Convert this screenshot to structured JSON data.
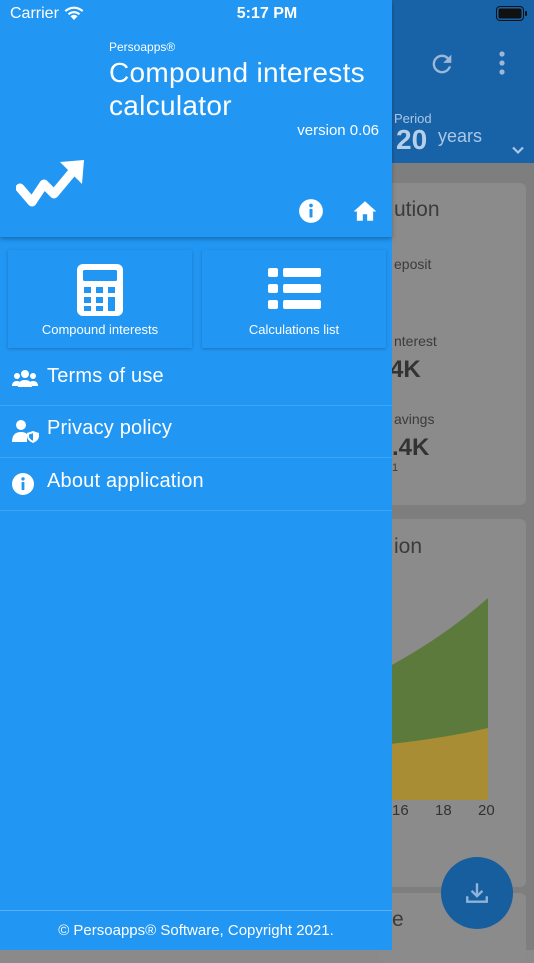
{
  "status_bar": {
    "carrier": "Carrier",
    "time": "5:17 PM"
  },
  "drawer": {
    "brand": "Persoapps®",
    "title_line1": "Compound interests",
    "title_line2": "calculator",
    "version": "version 0.06",
    "quick_links": [
      {
        "label": "Compound interests",
        "icon": "calculator-icon"
      },
      {
        "label": "Calculations list",
        "icon": "list-icon"
      }
    ],
    "menu": [
      {
        "label": "Terms of use",
        "icon": "users-icon"
      },
      {
        "label": "Privacy policy",
        "icon": "user-shield-icon"
      },
      {
        "label": "About application",
        "icon": "info-icon"
      }
    ],
    "footer": "© Persoapps® Software, Copyright 2021.",
    "accent_color": "#2196f3"
  },
  "background_screen": {
    "period_label": "Period",
    "period_value": "20",
    "period_unit": "years",
    "card1_title_fragment": "ution",
    "card1_rows": [
      {
        "label": "eposit",
        "value": ""
      },
      {
        "label": "nterest",
        "value": "4K"
      },
      {
        "label": "avings",
        "value": ".4K",
        "sub": "1"
      }
    ],
    "card2_title_fragment": "ion",
    "axis_ticks": [
      "16",
      "18",
      "20"
    ],
    "card3_title_fragment": "e"
  }
}
